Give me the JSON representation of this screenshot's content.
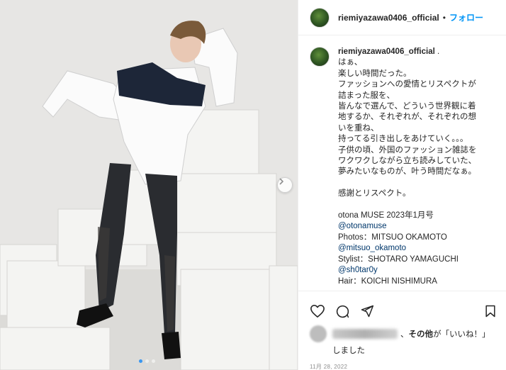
{
  "post": {
    "username": "riemiyazawa0406_official",
    "separator": "•",
    "follow_label": "フォロー"
  },
  "caption": {
    "username": "riemiyazawa0406_official",
    "dot": ".",
    "lines": [
      "はぁ、",
      "楽しい時間だった。",
      "ファッションへの愛情とリスペクトが",
      "詰まった服を、",
      "皆んなで選んで、どういう世界観に着",
      "地するか、それぞれが、それぞれの想",
      "いを重ね、",
      "持ってる引き出しをあけていく。。。",
      "子供の頃、外国のファッション雑誌を",
      "ワクワクしながら立ち読みしていた、",
      "夢みたいなものが、叶う時間だなぁ。",
      "",
      "感謝とリスペクト。",
      "",
      "otona MUSE 2023年1月号"
    ],
    "credits": [
      {
        "text": "@otonamuse",
        "link": true
      },
      {
        "text": "Photos：MITSUO OKAMOTO",
        "link": false
      },
      {
        "text": "@mitsuo_okamoto",
        "link": true
      },
      {
        "text": "Stylist：SHOTARO YAMAGUCHI",
        "link": false
      },
      {
        "text": "@sh0tar0y",
        "link": true
      },
      {
        "text": "Hair：KOICHI NISHIMURA",
        "link": false
      }
    ]
  },
  "likes": {
    "suffix_prefix": "、",
    "others_label": "その他",
    "mid": "が「いいね！」",
    "line2": "しました"
  },
  "date": "11月 28, 2022",
  "carousel": {
    "count": 3,
    "active_index": 0
  },
  "icons": {
    "like": "heart-icon",
    "comment": "comment-icon",
    "share": "share-icon",
    "save": "bookmark-icon",
    "next": "chevron-right-icon"
  },
  "colors": {
    "follow": "#0095f6",
    "link": "#00376b",
    "carousel_active": "#3a97f0"
  }
}
